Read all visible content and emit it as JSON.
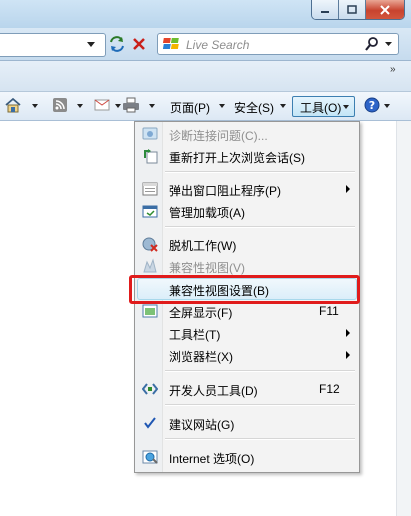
{
  "search": {
    "placeholder": "Live Search"
  },
  "command_bar": {
    "page_label": "页面(P)",
    "safety_label": "安全(S)",
    "tools_label": "工具(O)"
  },
  "tools_menu": {
    "items": [
      {
        "label": "诊断连接问题(C)...",
        "disabled": true
      },
      {
        "label": "重新打开上次浏览会话(S)"
      },
      {
        "label": "弹出窗口阻止程序(P)",
        "submenu": true
      },
      {
        "label": "管理加载项(A)"
      },
      {
        "label": "脱机工作(W)"
      },
      {
        "label": "兼容性视图(V)",
        "disabled": true
      },
      {
        "label": "兼容性视图设置(B)",
        "highlighted": true
      },
      {
        "label": "全屏显示(F)",
        "shortcut": "F11"
      },
      {
        "label": "工具栏(T)",
        "submenu": true
      },
      {
        "label": "浏览器栏(X)",
        "submenu": true
      },
      {
        "label": "开发人员工具(D)",
        "shortcut": "F12"
      },
      {
        "label": "建议网站(G)",
        "checked": true
      },
      {
        "label": "Internet 选项(O)"
      }
    ]
  },
  "colors": {
    "callout": "#e01b1b",
    "menu_background": "#f3f3f3",
    "close_button": "#c8432f"
  }
}
